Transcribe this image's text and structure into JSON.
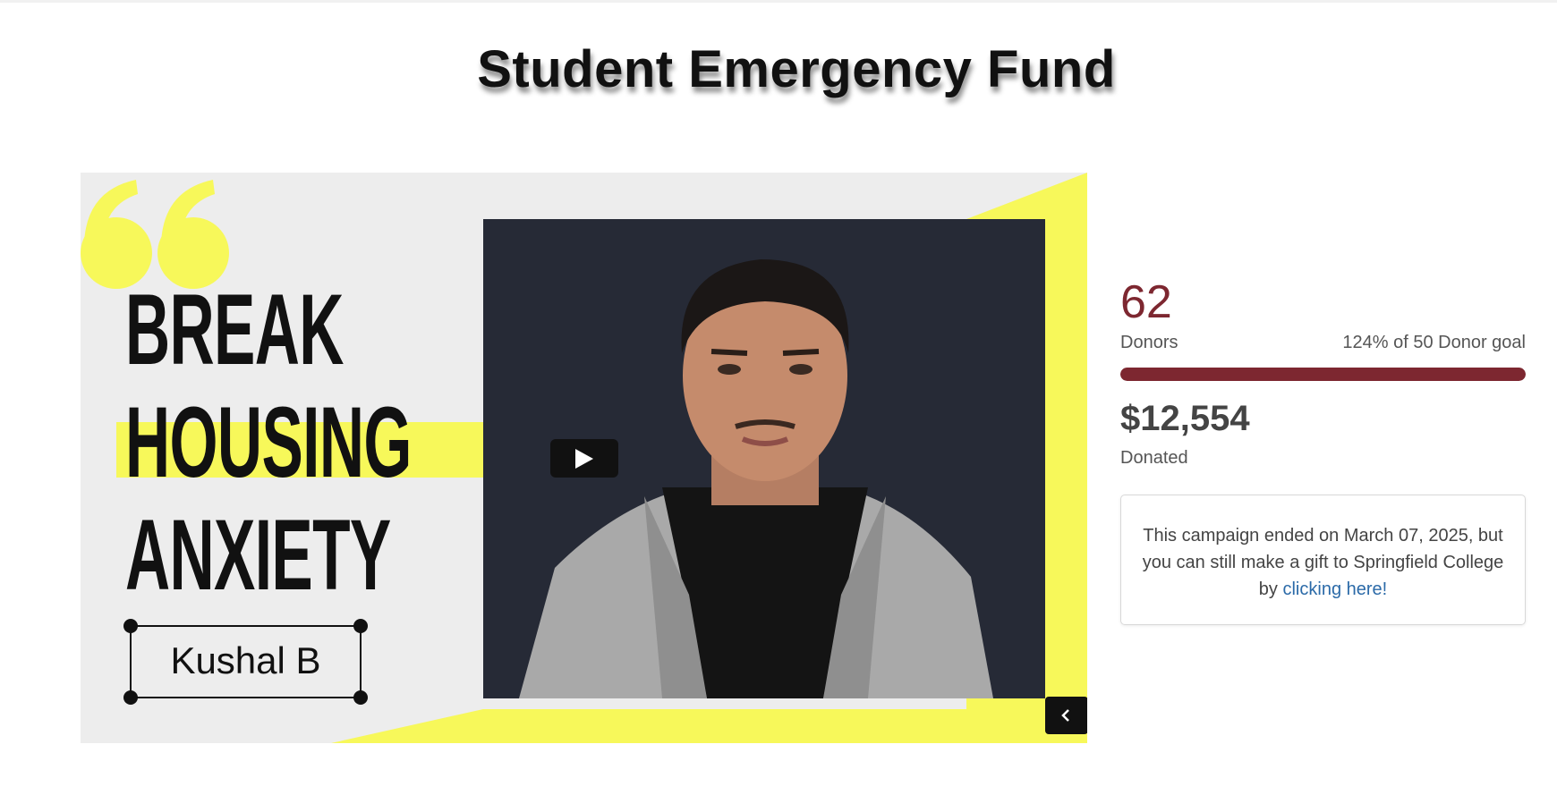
{
  "page": {
    "title": "Student Emergency Fund"
  },
  "media": {
    "headline_lines": [
      "BREAK",
      "HOUSING",
      "ANXIETY"
    ],
    "name": "Kushal B",
    "play_icon": "play-icon",
    "prev_icon": "chevron-left-icon",
    "accent_color": "#f7f85a"
  },
  "stats": {
    "donor_count": "62",
    "donor_label": "Donors",
    "donor_goal_text": "124% of 50 Donor goal",
    "progress_fraction": 1.0,
    "amount": "$12,554",
    "amount_label": "Donated",
    "brand_color": "#7d2730"
  },
  "notice": {
    "text": "This campaign ended on March 07, 2025, but you can still make a gift to Springfield College by ",
    "link_text": "clicking here!",
    "link_color": "#2b6aa8"
  }
}
